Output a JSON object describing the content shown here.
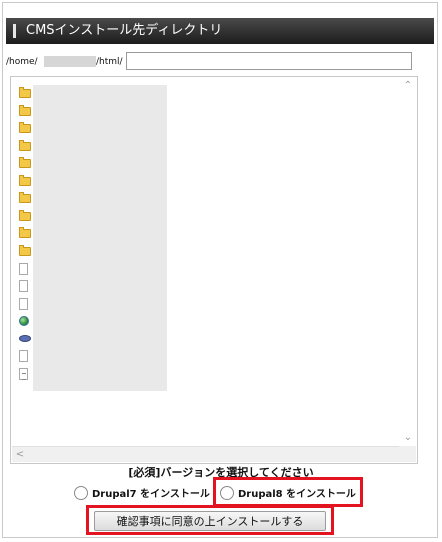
{
  "header": {
    "title": "CMSインストール先ディレクトリ"
  },
  "path": {
    "prefix": "/home/",
    "suffix": "/html/",
    "input_value": ""
  },
  "file_browser": {
    "items": [
      {
        "icon": "folder-icon"
      },
      {
        "icon": "folder-icon"
      },
      {
        "icon": "folder-icon"
      },
      {
        "icon": "folder-icon"
      },
      {
        "icon": "folder-icon"
      },
      {
        "icon": "folder-icon"
      },
      {
        "icon": "folder-icon"
      },
      {
        "icon": "folder-icon"
      },
      {
        "icon": "folder-icon"
      },
      {
        "icon": "folder-icon"
      },
      {
        "icon": "file-icon"
      },
      {
        "icon": "file-icon"
      },
      {
        "icon": "file-icon"
      },
      {
        "icon": "globe-file-icon"
      },
      {
        "icon": "php-file-icon"
      },
      {
        "icon": "file-icon"
      },
      {
        "icon": "text-file-icon"
      }
    ]
  },
  "instruction": "[必須]バージョンを選択してください",
  "options": [
    {
      "label": "Drupal7 をインストール"
    },
    {
      "label": "Drupal8 をインストール"
    }
  ],
  "submit": {
    "label": "確認事項に同意の上インストールする"
  },
  "colors": {
    "header_bg": "#2a2a2a",
    "highlight": "#e3141f",
    "folder": "#f3c846"
  }
}
